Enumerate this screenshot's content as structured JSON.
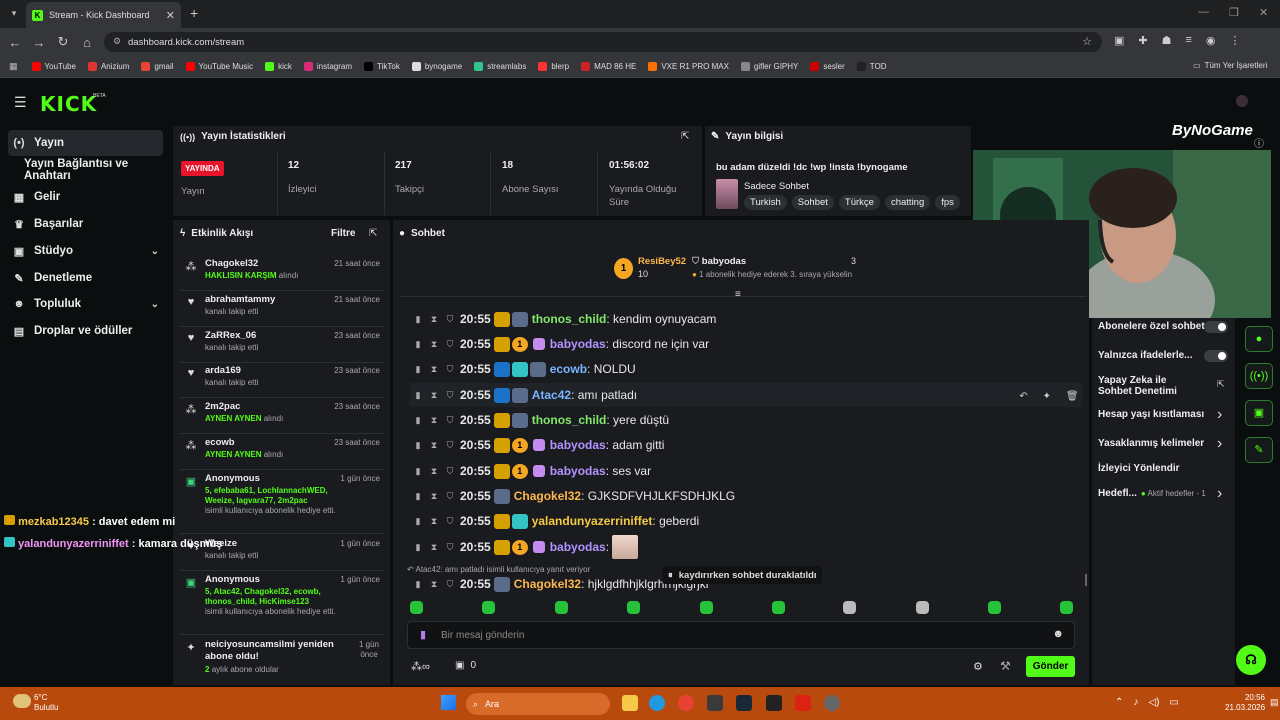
{
  "browser": {
    "tab_title": "Stream - Kick Dashboard",
    "url": "dashboard.kick.com/stream",
    "bookmarks": [
      "YouTube",
      "Anizium",
      "gmail",
      "YouTube Music",
      "kick",
      "instagram",
      "TikTok",
      "bynogame",
      "streamlabs",
      "blerp",
      "MAD 86 HE",
      "VXE R1 PRO MAX",
      "gifler GIPHY",
      "sesler",
      "TOD"
    ],
    "bookmarks_right": "Tüm Yer İşaretleri"
  },
  "kick": {
    "logo": "KICK",
    "beta": "BETA"
  },
  "sidebar": {
    "items": [
      {
        "icon": "(•)",
        "label": "Yayın"
      },
      {
        "icon": "",
        "label": "Yayın Bağlantısı ve Anahtarı"
      },
      {
        "icon": "▦",
        "label": "Gelir"
      },
      {
        "icon": "♛",
        "label": "Başarılar"
      },
      {
        "icon": "▣",
        "label": "Stüdyo"
      },
      {
        "icon": "✎",
        "label": "Denetleme"
      },
      {
        "icon": "☻",
        "label": "Topluluk"
      },
      {
        "icon": "▤",
        "label": "Droplar ve ödüller"
      }
    ]
  },
  "stats": {
    "title": "Yayın İstatistikleri",
    "live_badge": "YAYINDA",
    "live_label": "Yayın",
    "viewers": "12",
    "viewers_label": "İzleyici",
    "followers": "217",
    "followers_label": "Takipçi",
    "subs": "18",
    "subs_label": "Abone Sayısı",
    "uptime": "01:56:02",
    "uptime_label": "Yayında Olduğu Süre"
  },
  "stream_info": {
    "title": "Yayın bilgisi",
    "stream_title": "bu adam düzeldi !dc !wp !insta !bynogame",
    "category": "Sadece Sohbet",
    "tags": [
      "Turkish",
      "Sohbet",
      "Türkçe",
      "chatting",
      "fps"
    ]
  },
  "activity": {
    "title": "Etkinlik Akışı",
    "filter": "Filtre",
    "items": [
      {
        "name": "Chagokel32",
        "time": "21 saat önce",
        "green": "HAKLISIN KARŞIM",
        "sub": "alındı"
      },
      {
        "name": "abrahamtammy",
        "time": "21 saat önce",
        "green": "",
        "sub": "kanalı takip etti"
      },
      {
        "name": "ZaRRex_06",
        "time": "23 saat önce",
        "green": "",
        "sub": "kanalı takip etti"
      },
      {
        "name": "arda169",
        "time": "23 saat önce",
        "green": "",
        "sub": "kanalı takip etti"
      },
      {
        "name": "2m2pac",
        "time": "23 saat önce",
        "green": "AYNEN AYNEN",
        "sub": "alındı"
      },
      {
        "name": "ecowb",
        "time": "23 saat önce",
        "green": "AYNEN AYNEN",
        "sub": "alındı"
      },
      {
        "name": "Anonymous",
        "time": "1 gün önce",
        "green": "5, efebaba61, LochlannachWED, Weeize, lagvara77, 2m2pac",
        "sub": "isimli kullanıcıya abonelik hediye etti."
      },
      {
        "name": "Weeize",
        "time": "1 gün önce",
        "green": "",
        "sub": "kanalı takip etti"
      },
      {
        "name": "Anonymous",
        "time": "1 gün önce",
        "green": "5, Atac42, Chagokel32, ecowb, thonos_child, HicKimse123",
        "sub": "isimli kullanıcıya abonelik hediye etti."
      },
      {
        "name": "neiciyosuncamsilmi yeniden abone oldu!",
        "time": "1 gün önce",
        "green": "2",
        "sub": "aylık abone oldular"
      }
    ]
  },
  "overlay_chat": [
    {
      "user": "mezkab12345",
      "text": "davet edem mi"
    },
    {
      "user": "yalandunyazerriniffet",
      "text": "kamara düşmüş"
    }
  ],
  "chat": {
    "title": "Sohbet",
    "leader": {
      "name": "ResiBey52",
      "count": "10",
      "rank": "1"
    },
    "leader2": {
      "name": "babyodas",
      "count": "3",
      "note": "1 abonelik hediye ederek 3. sıraya yükselin"
    },
    "messages": [
      {
        "time": "20:55",
        "user": "thonos_child",
        "color": "c-green",
        "badges": [
          "crown",
          "av"
        ],
        "text": "kendim oynuyacam"
      },
      {
        "time": "20:55",
        "user": "babyodas",
        "color": "c-purple",
        "badges": [
          "crown",
          "gift",
          "pur"
        ],
        "text": "discord ne için var"
      },
      {
        "time": "20:55",
        "user": "ecowb",
        "color": "c-blue",
        "badges": [
          "pin",
          "bar",
          "av"
        ],
        "text": "NOLDU"
      },
      {
        "time": "20:55",
        "user": "Atac42",
        "color": "c-blue",
        "badges": [
          "pin",
          "av"
        ],
        "text": "amı patladı"
      },
      {
        "time": "20:55",
        "user": "thonos_child",
        "color": "c-green",
        "badges": [
          "crown",
          "av"
        ],
        "text": "yere düştü"
      },
      {
        "time": "20:55",
        "user": "babyodas",
        "color": "c-purple",
        "badges": [
          "crown",
          "gift",
          "pur"
        ],
        "text": "adam gitti"
      },
      {
        "time": "20:55",
        "user": "babyodas",
        "color": "c-purple",
        "badges": [
          "crown",
          "gift",
          "pur"
        ],
        "text": "ses var"
      },
      {
        "time": "20:55",
        "user": "Chagokel32",
        "color": "c-orange",
        "badges": [
          "av"
        ],
        "text": "GJKSDFVHJLKFSDHJKLG"
      },
      {
        "time": "20:55",
        "user": "yalandunyazerriniffet",
        "color": "c-yellow",
        "badges": [
          "crown",
          "bar"
        ],
        "text": "geberdi"
      },
      {
        "time": "20:55",
        "user": "babyodas",
        "color": "c-purple",
        "badges": [
          "crown",
          "gift",
          "pur"
        ],
        "text": ""
      }
    ],
    "reply_note": "Atac42: amı patladı isimli kullanıcıya yanıt veriyor",
    "paused": "kaydırırken sohbet duraklatıldı",
    "last_msg": {
      "time": "20:55",
      "user": "Chagokel32",
      "text": "hjklgdfhhjklgrhrhjklgrjkl"
    },
    "input_placeholder": "Bir mesaj gönderin",
    "count": "0",
    "send": "Gönder"
  },
  "settings": {
    "items": [
      {
        "label": "Abonelere özel sohbet",
        "kind": "toggle"
      },
      {
        "label": "Yalnızca ifadelerle...",
        "kind": "toggle"
      },
      {
        "label": "Yapay Zeka ile Sohbet Denetimi",
        "kind": "ext"
      },
      {
        "label": "Hesap yaşı kısıtlaması",
        "kind": "arrow"
      },
      {
        "label": "Yasaklanmış kelimeler",
        "kind": "arrow"
      },
      {
        "label": "İzleyici Yönlendir",
        "kind": "none"
      },
      {
        "label": "Hedefl...",
        "kind": "arrow",
        "extra": "Aktif hedefler - 1"
      }
    ]
  },
  "watermark": "ByNoGame",
  "taskbar": {
    "temp": "6°C",
    "weather": "Bulutlu",
    "search": "Ara",
    "time": "20:56",
    "date": "21.03.2026"
  },
  "colors": {
    "accent": "#53fc18",
    "panel": "#191b1f",
    "bg": "#0b0e0f"
  }
}
